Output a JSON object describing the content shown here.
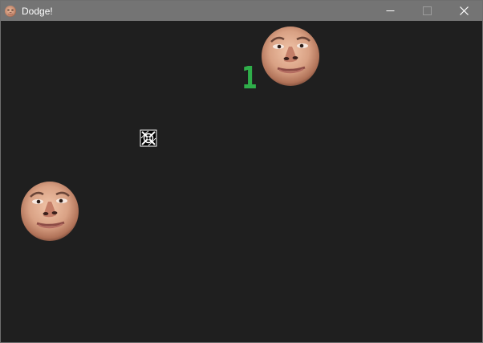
{
  "window": {
    "title": "Dodge!",
    "icon": "face-icon",
    "controls": [
      "minimize-icon",
      "maximize-icon",
      "close-icon"
    ]
  },
  "game": {
    "score": "1",
    "colors": {
      "background": "#1f1f1f",
      "score": "#2fae4a",
      "titlebar": "#747474"
    },
    "sprites": {
      "enemy": "face-icon",
      "player": "crosshair-icon"
    }
  }
}
